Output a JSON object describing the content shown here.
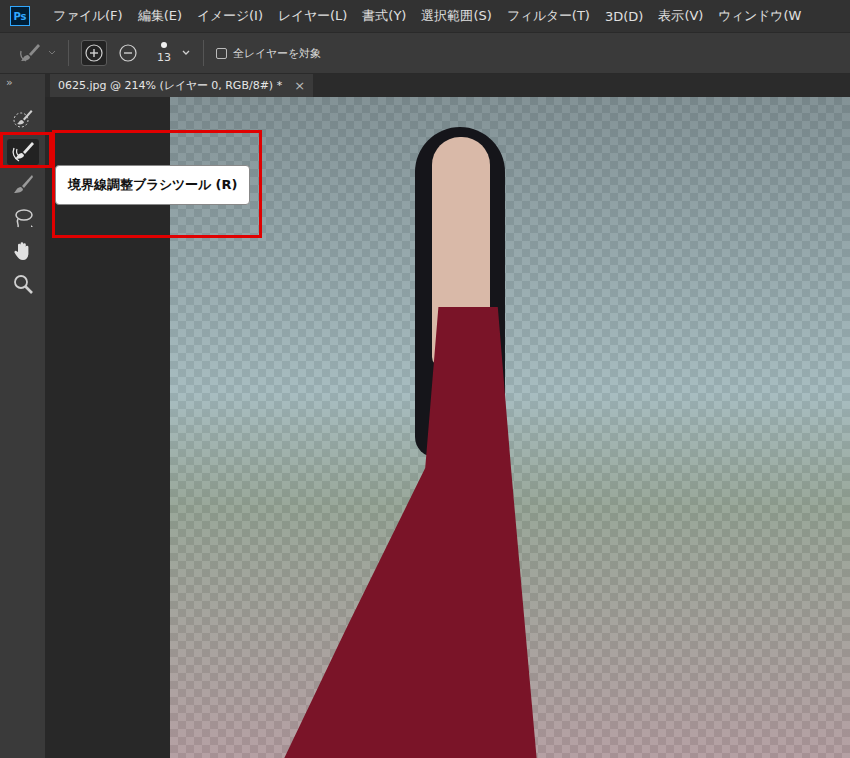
{
  "app": {
    "logo": "Ps"
  },
  "menu": [
    "ファイル(F)",
    "編集(E)",
    "イメージ(I)",
    "レイヤー(L)",
    "書式(Y)",
    "選択範囲(S)",
    "フィルター(T)",
    "3D(D)",
    "表示(V)",
    "ウィンドウ(W"
  ],
  "options_bar": {
    "mode_buttons": [
      {
        "kind": "add",
        "selected": true
      },
      {
        "kind": "subtract",
        "selected": false
      }
    ],
    "brush_size": "13",
    "sample_all_layers": {
      "label": "全レイヤーを対象",
      "checked": false
    }
  },
  "panel_toggle": "»",
  "tabs": [
    {
      "label": "0625.jpg @ 214% (レイヤー 0, RGB/8#) *",
      "close": "×",
      "selected": true
    }
  ],
  "tools": [
    {
      "kind": "quick-selection",
      "selected": false,
      "highlighted": false
    },
    {
      "kind": "refine-edge-brush",
      "selected": true,
      "highlighted": true
    },
    {
      "kind": "brush",
      "selected": false,
      "highlighted": false
    },
    {
      "kind": "lasso",
      "selected": false,
      "highlighted": false
    },
    {
      "kind": "hand",
      "selected": false,
      "highlighted": false
    },
    {
      "kind": "zoom",
      "selected": false,
      "highlighted": false
    }
  ],
  "tooltip": {
    "text": "境界線調整ブラシツール (R)",
    "highlighted": true
  }
}
